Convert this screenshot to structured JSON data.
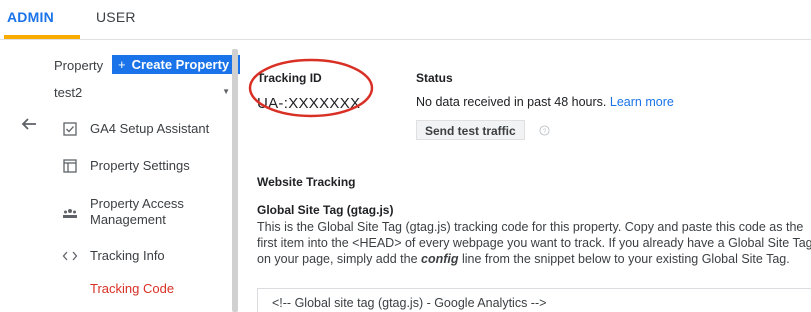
{
  "tabs": {
    "admin": "ADMIN",
    "user": "USER"
  },
  "sidebar": {
    "property_label": "Property",
    "create_label": "Create Property",
    "create_plus": "+",
    "selected_property": "test2",
    "items": [
      {
        "label": "GA4 Setup Assistant",
        "icon": "checkbox-icon"
      },
      {
        "label": "Property Settings",
        "icon": "window-icon"
      },
      {
        "label": "Property Access Management",
        "label_line1": "Property Access",
        "label_line2": "Management",
        "icon": "people-icon"
      },
      {
        "label": "Tracking Info",
        "icon": "code-icon"
      },
      {
        "label": "Tracking Code",
        "icon": ""
      }
    ]
  },
  "main": {
    "tracking_id_label": "Tracking ID",
    "tracking_id_value": "UA-:XXXXXXX",
    "status_label": "Status",
    "status_text": "No data received in past 48 hours.",
    "learn_more": "Learn more",
    "send_test": "Send test traffic",
    "website_tracking": "Website Tracking",
    "gtag_heading": "Global Site Tag (gtag.js)",
    "desc_line1": "This is the Global Site Tag (gtag.js) tracking code for this property. Copy and paste this code as the",
    "desc_line2": "first item into the <HEAD> of every webpage you want to track. If you already have a Global Site Tag",
    "desc_line3_pre": "on your page, simply add the",
    "desc_line3_config": "config",
    "desc_line3_post": "line from the snippet below to your existing Global Site Tag.",
    "snippet_first_line": "<!-- Global site tag (gtag.js) - Google Analytics -->"
  },
  "colors": {
    "accent": "#1a73e8",
    "tab_underline": "#f9ab00",
    "active_red": "#d93025",
    "highlight_red": "#d93025"
  }
}
